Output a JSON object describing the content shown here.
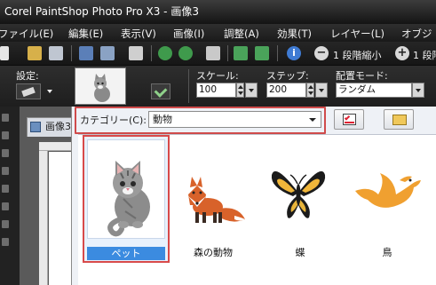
{
  "window": {
    "title": "Corel PaintShop Photo Pro X3 - 画像3"
  },
  "menu": {
    "items": [
      "ファイル(E)",
      "編集(E)",
      "表示(V)",
      "画像(I)",
      "調整(A)",
      "効果(T)",
      "レイヤー(L)",
      "オブジ"
    ]
  },
  "toolbar": {
    "zoom_out_label": "1 段階縮小",
    "zoom_in_label": "1 段階拡"
  },
  "options": {
    "settings_label": "設定:",
    "scale_label": "スケール:",
    "scale_value": "100",
    "step_label": "ステップ:",
    "step_value": "200",
    "placement_label": "配置モード:",
    "placement_value": "ランダム"
  },
  "document": {
    "tab_label": "画像3"
  },
  "dialog": {
    "category_label": "カテゴリー(C):",
    "category_value": "動物",
    "items": [
      {
        "label": "ペット",
        "icon": "cat-icon",
        "selected": true
      },
      {
        "label": "森の動物",
        "icon": "fox-icon",
        "selected": false
      },
      {
        "label": "蝶",
        "icon": "butterfly-icon",
        "selected": false
      },
      {
        "label": "鳥",
        "icon": "bird-icon",
        "selected": false
      }
    ]
  },
  "colors": {
    "selection_border": "#d84a4a",
    "selected_label_bg": "#3b8be0",
    "category_highlight": "#cf4b4b"
  }
}
